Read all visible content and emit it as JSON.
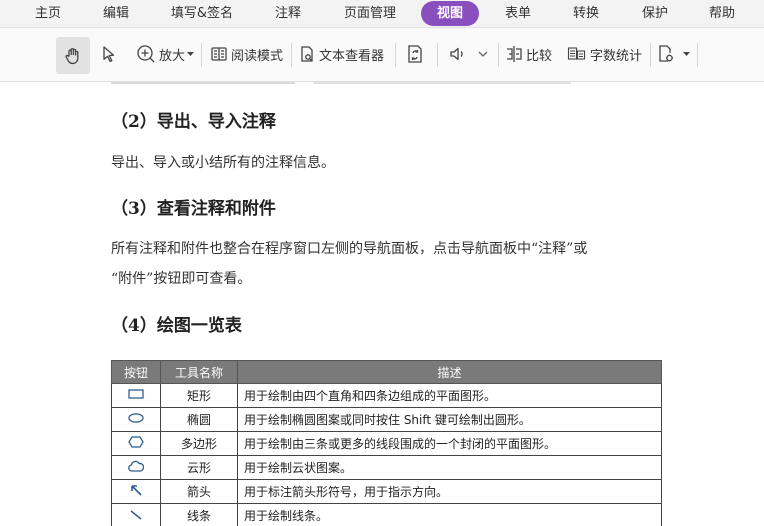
{
  "menu": {
    "items": [
      "主页",
      "编辑",
      "填写&签名",
      "注释",
      "页面管理",
      "视图",
      "表单",
      "转换",
      "保护",
      "帮助"
    ],
    "active": "视图"
  },
  "toolbar": {
    "zoom_label": "放大",
    "read_mode_label": "阅读模式",
    "text_viewer_label": "文本查看器",
    "compare_label": "比较",
    "word_count_label": "字数统计"
  },
  "doc": {
    "heading2": "（2）导出、导入注释",
    "para2": "导出、导入或小结所有的注释信息。",
    "heading3": "（3）查看注释和附件",
    "para3_line1": "所有注释和附件也整合在程序窗口左侧的导航面板，点击导航面板中“注释”或",
    "para3_line2": "“附件”按钮即可查看。",
    "heading4": "（4）绘图一览表"
  },
  "table": {
    "headers": [
      "按钮",
      "工具名称",
      "描述"
    ],
    "rows": [
      {
        "icon": "rectangle-icon",
        "name": "矩形",
        "desc": "用于绘制由四个直角和四条边组成的平面图形。"
      },
      {
        "icon": "ellipse-icon",
        "name": "椭圆",
        "desc": "用于绘制椭圆图案或同时按住 Shift 键可绘制出圆形。"
      },
      {
        "icon": "polygon-icon",
        "name": "多边形",
        "desc": "用于绘制由三条或更多的线段围成的一个封闭的平面图形。"
      },
      {
        "icon": "cloud-icon",
        "name": "云形",
        "desc": "用于绘制云状图案。"
      },
      {
        "icon": "arrow-icon",
        "name": "箭头",
        "desc": "用于标注箭头形符号，用于指示方向。"
      },
      {
        "icon": "line-icon",
        "name": "线条",
        "desc": "用于绘制线条。"
      }
    ]
  },
  "colors": {
    "active_tab": "#8a4fbe",
    "table_header": "#7a7a7a"
  }
}
